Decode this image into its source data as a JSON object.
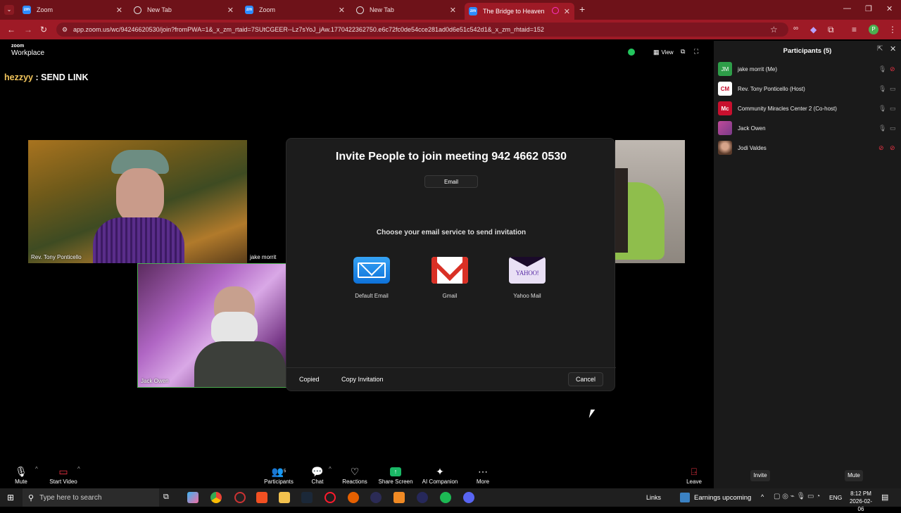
{
  "browser": {
    "tabs": [
      {
        "label": "Zoom",
        "kind": "zoom"
      },
      {
        "label": "New Tab",
        "kind": "globe"
      },
      {
        "label": "Zoom",
        "kind": "zoom"
      },
      {
        "label": "New Tab",
        "kind": "globe"
      },
      {
        "label": "The Bridge to Heaven",
        "kind": "zoom",
        "active": true
      }
    ],
    "url": "app.zoom.us/wc/94246620530/join?fromPWA=1&_x_zm_rtaid=7SUtCGEER--Lz7sYoJ_jAw.1770422362750.e6c72fc0de54cce281ad0d6e51c542d1&_x_zm_rhtaid=152",
    "profile_initial": "P"
  },
  "zoom": {
    "logo_line1": "zoom",
    "logo_line2": "Workplace",
    "view_label": "View",
    "banner_name": "hezzyy",
    "banner_sep": " : ",
    "banner_text": "SEND LINK",
    "tiles": {
      "tony": "Rev. Tony Ponticello",
      "jake": "jake morrit",
      "jack": "Jack Owen"
    }
  },
  "dialog": {
    "title": "Invite People to join meeting 942 4662 0530",
    "tab_email": "Email",
    "subtitle": "Choose your email service to send invitation",
    "services": [
      {
        "label": "Default Email",
        "icon": "envelope-icon"
      },
      {
        "label": "Gmail",
        "icon": "gmail-icon"
      },
      {
        "label": "Yahoo Mail",
        "icon": "yahoo-icon"
      }
    ],
    "yahoo_logo_text": "YAHOO!",
    "copied": "Copied",
    "copy_invitation": "Copy Invitation",
    "cancel": "Cancel"
  },
  "toolbar": {
    "mute": "Mute",
    "start_video": "Start Video",
    "participants": "Participants",
    "participants_count": "5",
    "chat": "Chat",
    "reactions": "Reactions",
    "share_screen": "Share Screen",
    "ai_companion": "AI Companion",
    "more": "More",
    "leave": "Leave"
  },
  "panel": {
    "title": "Participants (5)",
    "participants": [
      {
        "name": "jake morrit (Me)",
        "initials": "JM",
        "color": "#2e9e49",
        "mic": "on",
        "video": "off"
      },
      {
        "name": "Rev. Tony Ponticello (Host)",
        "initials": "CM",
        "color": "#ffffff",
        "mic": "on",
        "video": "on"
      },
      {
        "name": "Community Miracles Center 2 (Co-host)",
        "initials": "Mc",
        "color": "#c8102e",
        "mic": "on",
        "video": "on"
      },
      {
        "name": "Jack Owen",
        "initials": "",
        "color": "#c04a9a",
        "mic": "on",
        "video": "on"
      },
      {
        "name": "Jodi Valdes",
        "initials": "",
        "color": "#9a6a50",
        "mic": "off",
        "video": "off"
      }
    ],
    "invite": "Invite",
    "mute": "Mute"
  },
  "taskbar": {
    "search_placeholder": "Type here to search",
    "links": "Links",
    "news": "Earnings upcoming",
    "lang": "ENG",
    "time": "8:12 PM",
    "date": "2026-02-06"
  }
}
